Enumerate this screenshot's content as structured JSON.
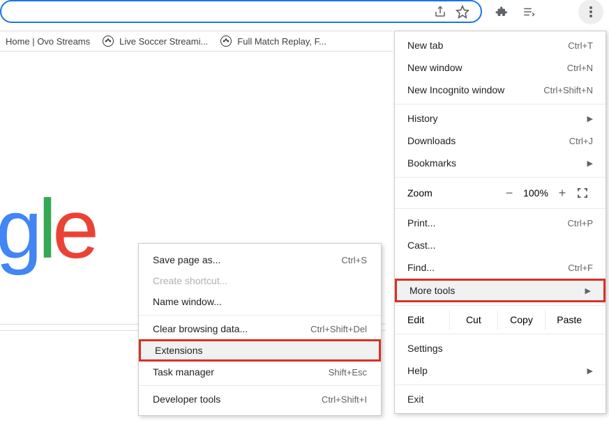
{
  "bookmarks": [
    {
      "label": "Home | Ovo Streams",
      "icon": "blank"
    },
    {
      "label": "Live Soccer Streami...",
      "icon": "soccer"
    },
    {
      "label": "Full Match Replay, F...",
      "icon": "soccer"
    }
  ],
  "main_menu": {
    "new_tab": {
      "label": "New tab",
      "shortcut": "Ctrl+T"
    },
    "new_window": {
      "label": "New window",
      "shortcut": "Ctrl+N"
    },
    "new_incognito": {
      "label": "New Incognito window",
      "shortcut": "Ctrl+Shift+N"
    },
    "history": {
      "label": "History"
    },
    "downloads": {
      "label": "Downloads",
      "shortcut": "Ctrl+J"
    },
    "bookmarks": {
      "label": "Bookmarks"
    },
    "zoom": {
      "label": "Zoom",
      "value": "100%",
      "minus": "−",
      "plus": "+"
    },
    "print": {
      "label": "Print...",
      "shortcut": "Ctrl+P"
    },
    "cast": {
      "label": "Cast..."
    },
    "find": {
      "label": "Find...",
      "shortcut": "Ctrl+F"
    },
    "more_tools": {
      "label": "More tools"
    },
    "edit": {
      "label": "Edit",
      "cut": "Cut",
      "copy": "Copy",
      "paste": "Paste"
    },
    "settings": {
      "label": "Settings"
    },
    "help": {
      "label": "Help"
    },
    "exit": {
      "label": "Exit"
    }
  },
  "submenu": {
    "save_page": {
      "label": "Save page as...",
      "shortcut": "Ctrl+S"
    },
    "create_shortcut": {
      "label": "Create shortcut..."
    },
    "name_window": {
      "label": "Name window..."
    },
    "clear_data": {
      "label": "Clear browsing data...",
      "shortcut": "Ctrl+Shift+Del"
    },
    "extensions": {
      "label": "Extensions"
    },
    "task_manager": {
      "label": "Task manager",
      "shortcut": "Shift+Esc"
    },
    "dev_tools": {
      "label": "Developer tools",
      "shortcut": "Ctrl+Shift+I"
    }
  }
}
